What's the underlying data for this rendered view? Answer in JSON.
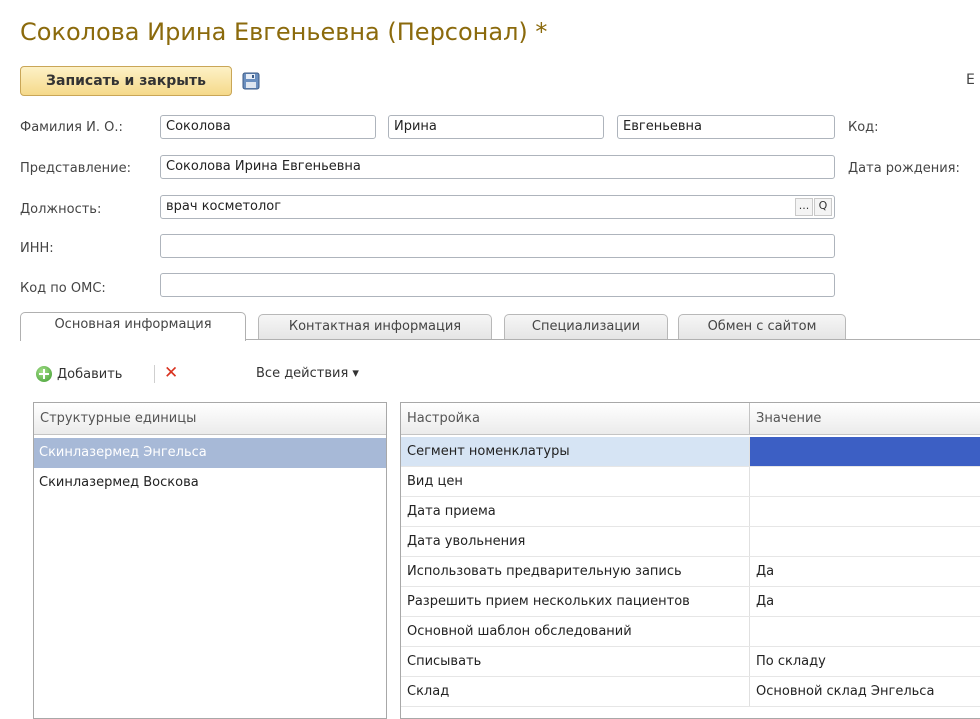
{
  "window": {
    "title": "Соколова Ирина Евгеньевна (Персонал) *"
  },
  "toolbar": {
    "save_close_label": "Записать и закрыть",
    "edge_letter": "Е"
  },
  "form": {
    "fio_label": "Фамилия И. О.:",
    "last_name": "Соколова",
    "first_name": "Ирина",
    "middle_name": "Евгеньевна",
    "code_label": "Код:",
    "representation_label": "Представление:",
    "representation": "Соколова Ирина Евгеньевна",
    "birth_date_label": "Дата рождения:",
    "position_label": "Должность:",
    "position": "врач косметолог",
    "position_ellipsis": "...",
    "position_search": "Q",
    "inn_label": "ИНН:",
    "inn": "",
    "oms_label": "Код по ОМС:",
    "oms": ""
  },
  "tabs": [
    {
      "label": "Основная информация",
      "active": true
    },
    {
      "label": "Контактная информация",
      "active": false
    },
    {
      "label": "Специализации",
      "active": false
    },
    {
      "label": "Обмен с сайтом",
      "active": false
    }
  ],
  "panel_toolbar": {
    "add_label": "Добавить",
    "delete_icon": "✕",
    "all_actions_label": "Все действия ▾"
  },
  "units_table": {
    "header": "Структурные единицы",
    "rows": [
      "Скинлазермед Энгельса",
      "Скинлазермед Воскова"
    ],
    "selected_index": 0
  },
  "settings_table": {
    "headers": {
      "setting": "Настройка",
      "value": "Значение"
    },
    "rows": [
      {
        "setting": "Сегмент номенклатуры",
        "value": ""
      },
      {
        "setting": "Вид цен",
        "value": ""
      },
      {
        "setting": "Дата приема",
        "value": ""
      },
      {
        "setting": "Дата увольнения",
        "value": ""
      },
      {
        "setting": "Использовать предварительную запись",
        "value": "Да"
      },
      {
        "setting": "Разрешить прием нескольких пациентов",
        "value": "Да"
      },
      {
        "setting": "Основной шаблон обследований",
        "value": ""
      },
      {
        "setting": "Списывать",
        "value": "По складу"
      },
      {
        "setting": "Склад",
        "value": "Основной склад Энгельса"
      }
    ]
  },
  "colors": {
    "title": "#8b6a0c",
    "selection": "#a7b9d7",
    "value_selected": "#3c5fc4",
    "row_highlight": "#d6e4f4"
  },
  "icons": {
    "save": "floppy-disk-icon",
    "add": "plus-circle-icon",
    "delete": "red-x-icon",
    "search": "magnifier-icon"
  }
}
